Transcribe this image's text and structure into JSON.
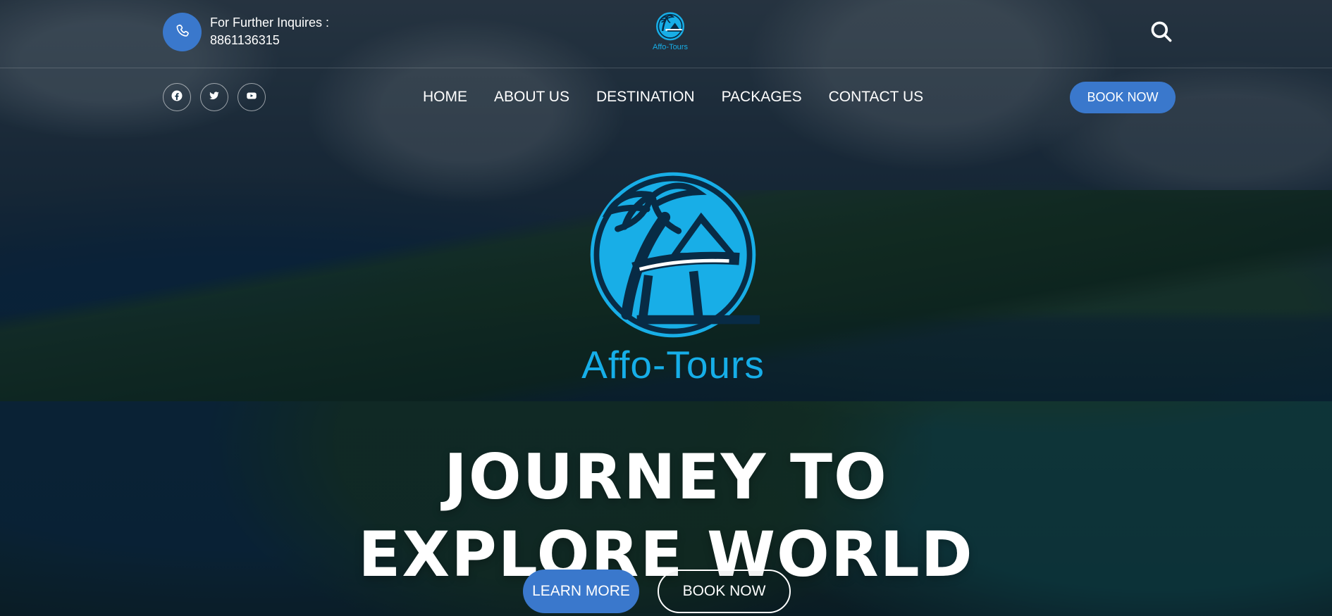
{
  "brand": {
    "name": "Affo-Tours",
    "hero_name": "Affo-Tours",
    "accent_color": "#3a78cc",
    "logo_color": "#18aee7"
  },
  "topbar": {
    "phone_icon": "phone-icon",
    "inquiry_label": "For Further Inquires :",
    "phone_number": "8861136315",
    "search_icon": "search-icon"
  },
  "social": [
    {
      "name": "facebook",
      "icon": "facebook-icon"
    },
    {
      "name": "twitter",
      "icon": "twitter-icon"
    },
    {
      "name": "youtube",
      "icon": "youtube-icon"
    }
  ],
  "nav": {
    "items": [
      {
        "label": "HOME"
      },
      {
        "label": "ABOUT US"
      },
      {
        "label": "DESTINATION"
      },
      {
        "label": "PACKAGES"
      },
      {
        "label": "CONTACT US"
      }
    ],
    "book_label": "BOOK NOW"
  },
  "hero": {
    "title_line1": "JOURNEY TO",
    "title_line2": "EXPLORE WORLD",
    "primary_button": "LEARN MORE",
    "secondary_button": "BOOK NOW"
  }
}
